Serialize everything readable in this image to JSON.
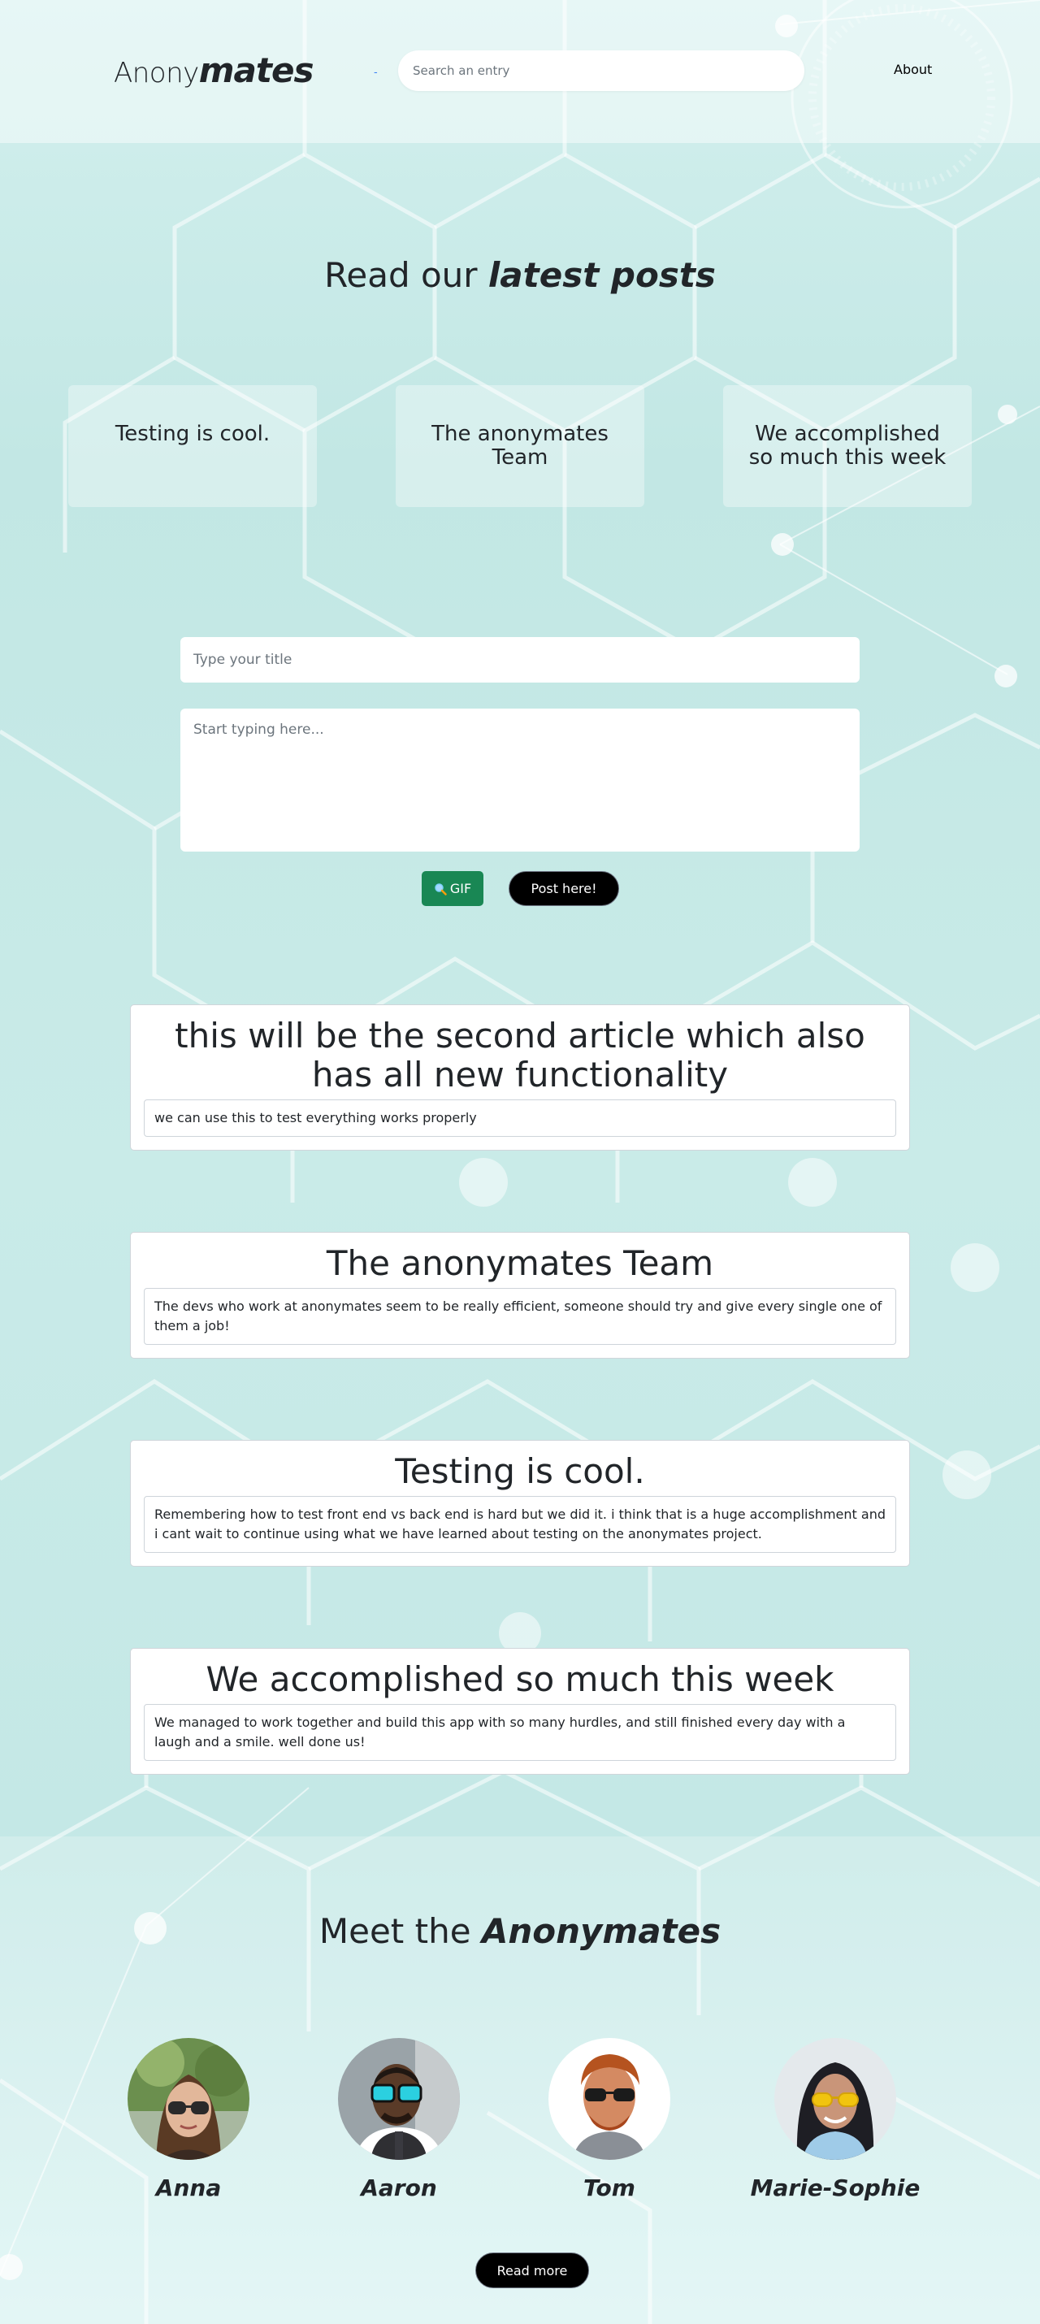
{
  "header": {
    "logo_light": "Anony",
    "logo_bold": "mates",
    "search_placeholder": "Search an entry",
    "nav_about": "About"
  },
  "latest": {
    "title_plain": "Read our ",
    "title_emph": "latest posts",
    "cards": [
      {
        "title": "Testing is cool."
      },
      {
        "title": "The anonymates Team"
      },
      {
        "title": "We accomplished so much this week"
      }
    ]
  },
  "form": {
    "title_placeholder": "Type your title",
    "body_placeholder": "Start typing here...",
    "gif_label": "GIF",
    "post_label": "Post here!"
  },
  "articles": [
    {
      "title": "this will be the second article which also has all new functionality",
      "body": "we can use this to test everything works properly"
    },
    {
      "title": "The anonymates Team",
      "body": "The devs who work at anonymates seem to be really efficient, someone should try and give every single one of them a job!"
    },
    {
      "title": "Testing is cool.",
      "body": "Remembering how to test front end vs back end is hard but we did it. i think that is a huge accomplishment and i cant wait to continue using what we have learned about testing on the anonymates project."
    },
    {
      "title": "We accomplished so much this week",
      "body": "We managed to work together and build this app with so many hurdles, and still finished every day with a laugh and a smile. well done us!"
    }
  ],
  "team": {
    "title_plain": "Meet the ",
    "title_emph": "Anonymates",
    "members": [
      {
        "name": "Anna"
      },
      {
        "name": "Aaron"
      },
      {
        "name": "Tom"
      },
      {
        "name": "Marie-Sophie"
      }
    ],
    "read_more_label": "Read more"
  },
  "colors": {
    "background": "#c8ebe8",
    "gif_button": "#198754",
    "post_button": "#000000"
  }
}
